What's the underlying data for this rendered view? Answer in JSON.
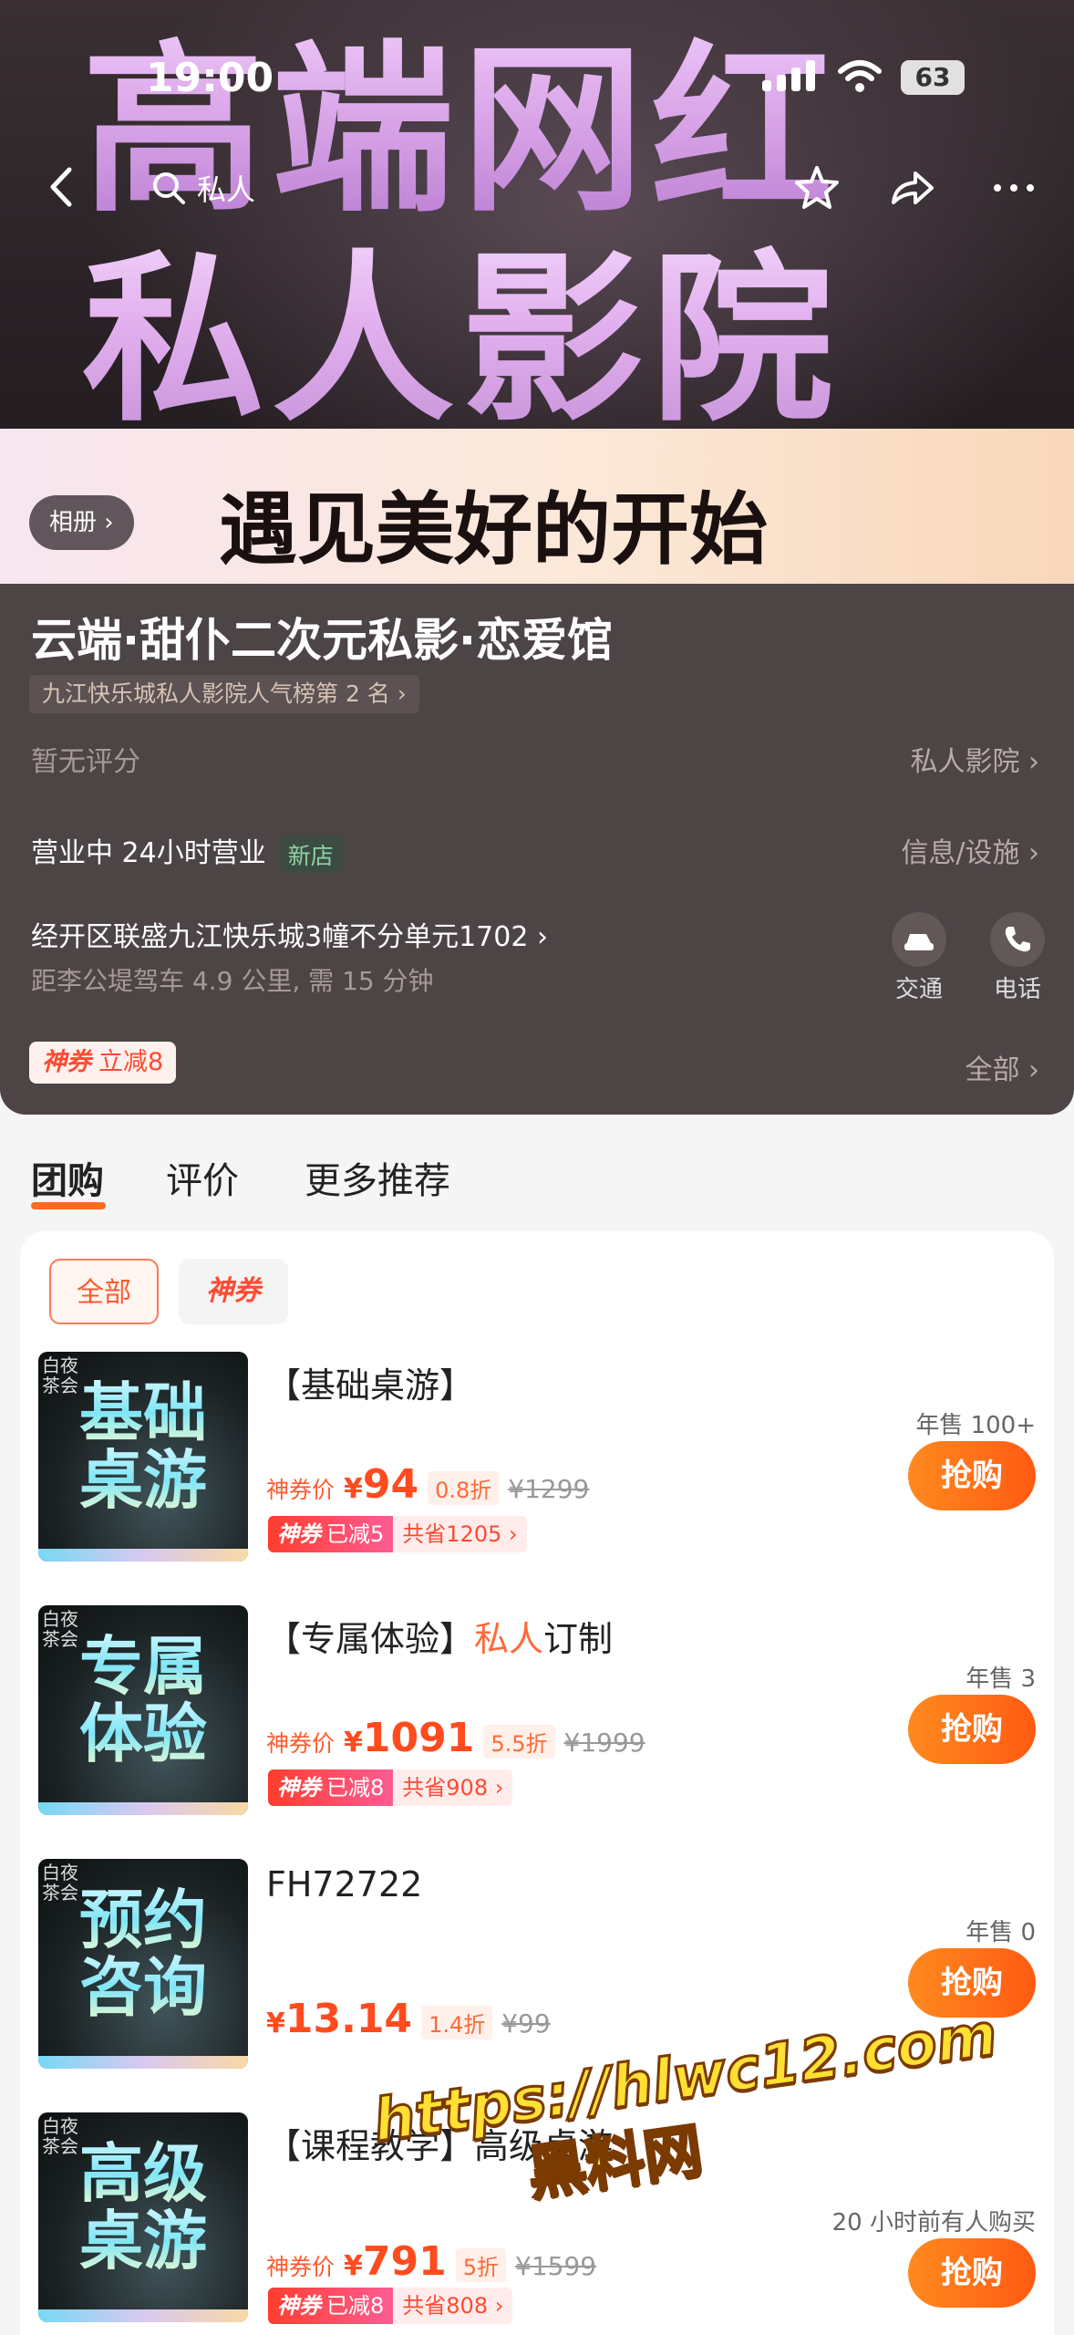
{
  "status_bar": {
    "time": "19:00",
    "battery": "63"
  },
  "nav": {
    "search_text": "私人"
  },
  "hero": {
    "line1": "高端网红",
    "line2": "私人影院",
    "slogan": "遇见美好的开始",
    "album_label": "相册 ›"
  },
  "shop": {
    "name": "云端·甜仆二次元私影·恋爱馆",
    "rank": "九江快乐城私人影院人气榜第 2 名 ›",
    "rating": "暂无评分",
    "category": "私人影院 ›",
    "status": "营业中 24小时营业",
    "new_tag": "新店",
    "facilities": "信息/设施 ›",
    "address": "经开区联盛九江快乐城3幢不分单元1702 ›",
    "distance": "距李公堤驾车 4.9 公里, 需 15 分钟",
    "traffic_label": "交通",
    "phone_label": "电话",
    "coupon_brand": "神券",
    "coupon_text": "立减8",
    "all_label": "全部 ›"
  },
  "tabs": [
    {
      "label": "团购"
    },
    {
      "label": "评价"
    },
    {
      "label": "更多推荐"
    }
  ],
  "filters": {
    "all": "全部",
    "shenquan": "神券"
  },
  "items": [
    {
      "thumb_tag1": "白夜",
      "thumb_tag2": "茶会",
      "thumb_line1": "基础",
      "thumb_line2": "桌游",
      "title": "【基础桌游】",
      "title_hl": "",
      "title_tail": "",
      "price_label": "神券价",
      "currency": "¥",
      "price": "94",
      "discount": "0.8折",
      "orig": "¥1299",
      "save_brand": "神券",
      "save_left": "已减5",
      "save_right": "共省1205 ›",
      "sold": "年售 100+",
      "buy": "抢购"
    },
    {
      "thumb_tag1": "白夜",
      "thumb_tag2": "茶会",
      "thumb_line1": "专属",
      "thumb_line2": "体验",
      "title": "【专属体验】",
      "title_hl": "私人",
      "title_tail": "订制",
      "price_label": "神券价",
      "currency": "¥",
      "price": "1091",
      "discount": "5.5折",
      "orig": "¥1999",
      "save_brand": "神券",
      "save_left": "已减8",
      "save_right": "共省908 ›",
      "sold": "年售 3",
      "buy": "抢购"
    },
    {
      "thumb_tag1": "白夜",
      "thumb_tag2": "茶会",
      "thumb_line1": "预约",
      "thumb_line2": "咨询",
      "title": "FH72722",
      "title_hl": "",
      "title_tail": "",
      "price_label": "",
      "currency": "¥",
      "price": "13.14",
      "discount": "1.4折",
      "orig": "¥99",
      "save_brand": "",
      "save_left": "",
      "save_right": "",
      "sold": "年售 0",
      "buy": "抢购"
    },
    {
      "thumb_tag1": "白夜",
      "thumb_tag2": "茶会",
      "thumb_line1": "高级",
      "thumb_line2": "桌游",
      "title": "【课程教学】高级桌游",
      "title_hl": "",
      "title_tail": "",
      "price_label": "神券价",
      "currency": "¥",
      "price": "791",
      "discount": "5折",
      "orig": "¥1599",
      "save_brand": "神券",
      "save_left": "已减8",
      "save_right": "共省808 ›",
      "sold": "20 小时前有人购买",
      "buy": "抢购"
    }
  ],
  "watermark": {
    "url": "https://hlwc12.com",
    "name": "黑料网"
  }
}
